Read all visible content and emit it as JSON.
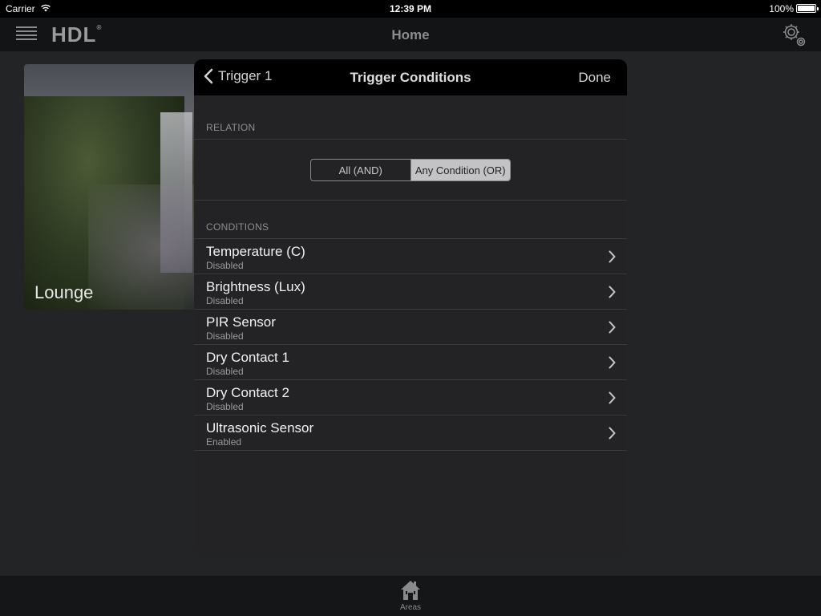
{
  "status_bar": {
    "carrier": "Carrier",
    "time": "12:39 PM",
    "battery": "100%"
  },
  "nav": {
    "logo": "HDL",
    "logo_mark": "®",
    "title": "Home"
  },
  "area_card": {
    "label": "Lounge"
  },
  "modal": {
    "back_label": "Trigger 1",
    "title": "Trigger Conditions",
    "done_label": "Done",
    "relation_header": "RELATION",
    "relation_options": [
      {
        "label": "All (AND)",
        "selected": false
      },
      {
        "label": "Any Condition (OR)",
        "selected": true
      }
    ],
    "conditions_header": "CONDITIONS",
    "conditions": [
      {
        "title": "Temperature (C)",
        "status": "Disabled"
      },
      {
        "title": "Brightness (Lux)",
        "status": "Disabled"
      },
      {
        "title": "PIR Sensor",
        "status": "Disabled"
      },
      {
        "title": "Dry Contact 1",
        "status": "Disabled"
      },
      {
        "title": "Dry Contact 2",
        "status": "Disabled"
      },
      {
        "title": "Ultrasonic Sensor",
        "status": "Enabled"
      }
    ]
  },
  "tab_bar": {
    "items": [
      {
        "label": "Areas",
        "icon": "home-icon"
      }
    ]
  }
}
